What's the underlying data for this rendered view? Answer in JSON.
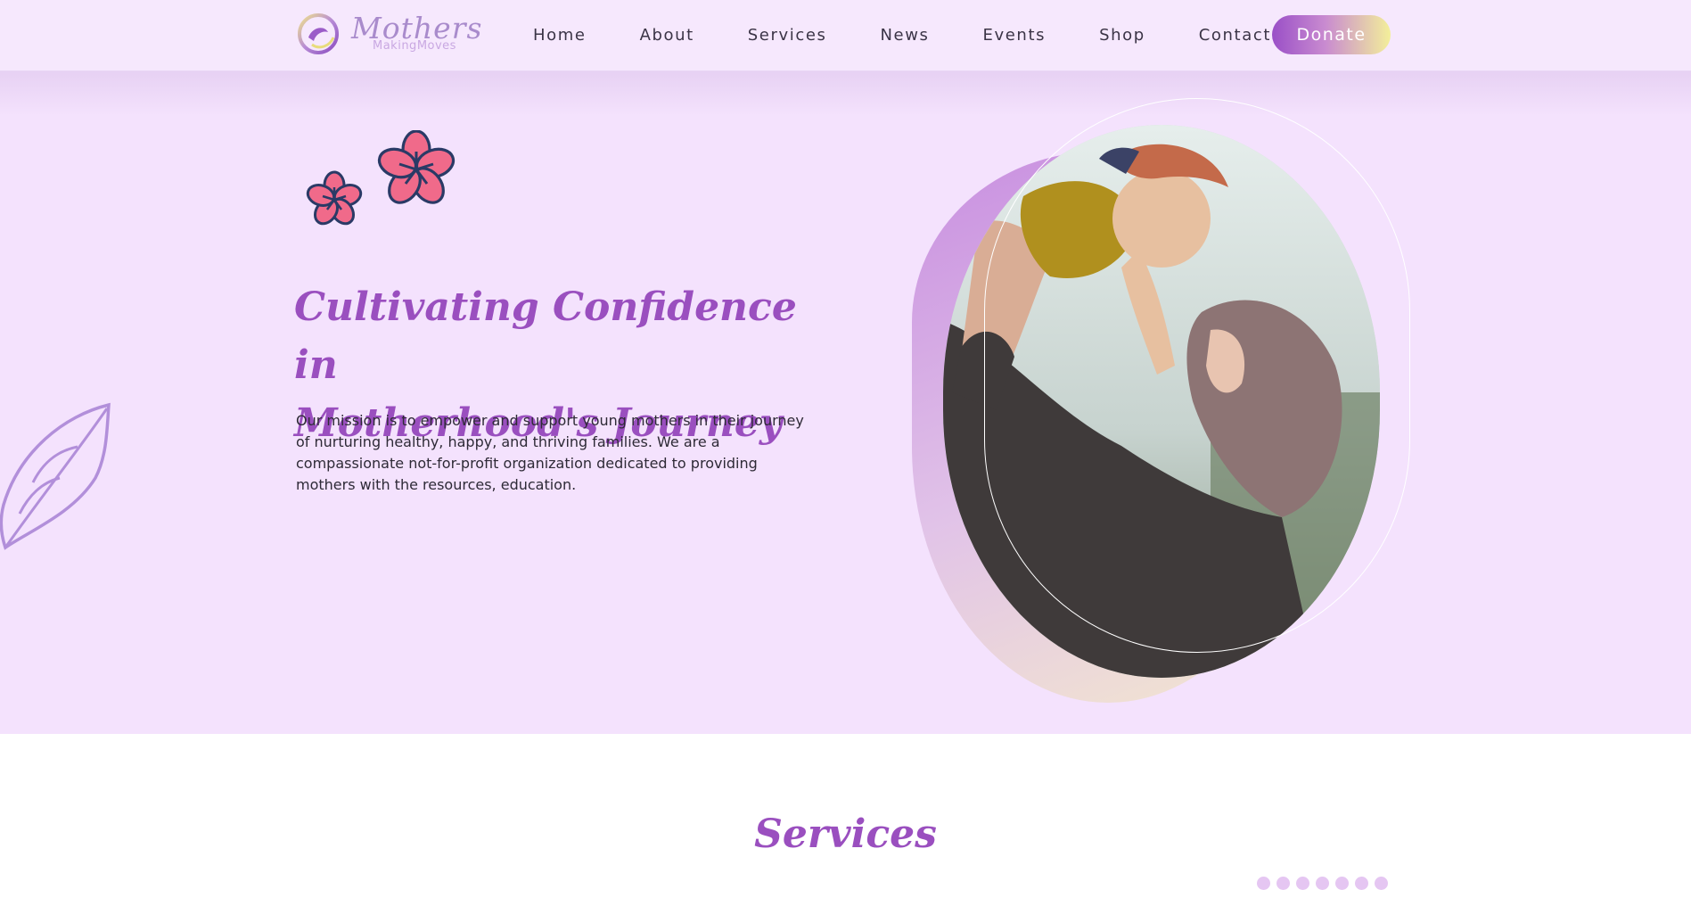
{
  "brand": {
    "title": "Mothers",
    "subtitle": "MakingMoves",
    "logo_icon": "mother-swirl-icon"
  },
  "nav": {
    "items": [
      {
        "label": "Home"
      },
      {
        "label": "About"
      },
      {
        "label": "Services"
      },
      {
        "label": "News"
      },
      {
        "label": "Events"
      },
      {
        "label": "Shop"
      },
      {
        "label": "Contact"
      }
    ],
    "donate_label": "Donate"
  },
  "hero": {
    "title_line1": "Cultivating Confidence in",
    "title_line2": "Motherhood's Journey",
    "body": "Our mission is to empower and support young mothers in their journey of nurturing healthy, happy, and thriving families. We are a compassionate not-for-profit organization dedicated to providing mothers with the resources, education.",
    "decor_icons": [
      "flower-icon",
      "leaf-icon"
    ]
  },
  "services": {
    "title": "Services",
    "carousel_dot_count": 7
  },
  "colors": {
    "header_bg": "#f6e8fd",
    "hero_bg": "#f4e2fd",
    "accent_purple": "#9a4fbf",
    "flower_pink": "#f06a8a",
    "flower_stroke": "#2a3a66"
  }
}
